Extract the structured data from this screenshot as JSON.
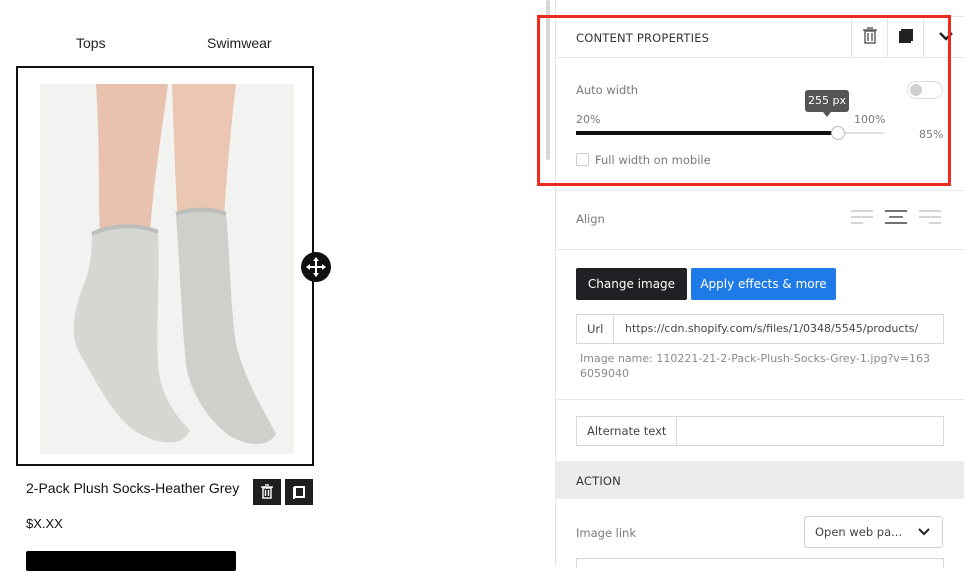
{
  "canvas": {
    "nav": [
      "Tops",
      "Swimwear"
    ],
    "product": {
      "title": "2-Pack Plush Socks-Heather Grey",
      "price": "$X.XX"
    },
    "icons": {
      "move": "move-arrows-icon",
      "delete": "trash-icon",
      "duplicate": "copy-icon"
    }
  },
  "panel": {
    "content_properties": {
      "title": "CONTENT PROPERTIES",
      "icons": [
        "trash-icon",
        "copy-icon",
        "chevron-down-icon"
      ]
    },
    "auto_width": {
      "label": "Auto width",
      "toggle_on": false,
      "min_label": "20%",
      "max_label": "100%",
      "value_percent": 85,
      "value_label": "85%",
      "tooltip": "255 px"
    },
    "full_width_mobile": {
      "label": "Full width on mobile",
      "checked": false
    },
    "align": {
      "label": "Align",
      "options": [
        "align-left-icon",
        "align-center-icon",
        "align-right-icon"
      ],
      "selected": "align-center-icon"
    },
    "image": {
      "change_label": "Change image",
      "effects_label": "Apply effects & more",
      "url_prefix": "Url",
      "url_value": "https://cdn.shopify.com/s/files/1/0348/5545/products/",
      "image_name_line1": "Image name:  110221-21-2-Pack-Plush-Socks-Grey-1.jpg?v=163",
      "image_name_line2": "6059040",
      "alt_prefix": "Alternate text",
      "alt_value": ""
    },
    "action": {
      "title": "ACTION",
      "image_link_label": "Image link",
      "image_link_value": "Open web pa..."
    }
  },
  "colors": {
    "highlight": "#ee2b1e",
    "accent_blue": "#1e7ae6",
    "dark_button": "#202124"
  }
}
